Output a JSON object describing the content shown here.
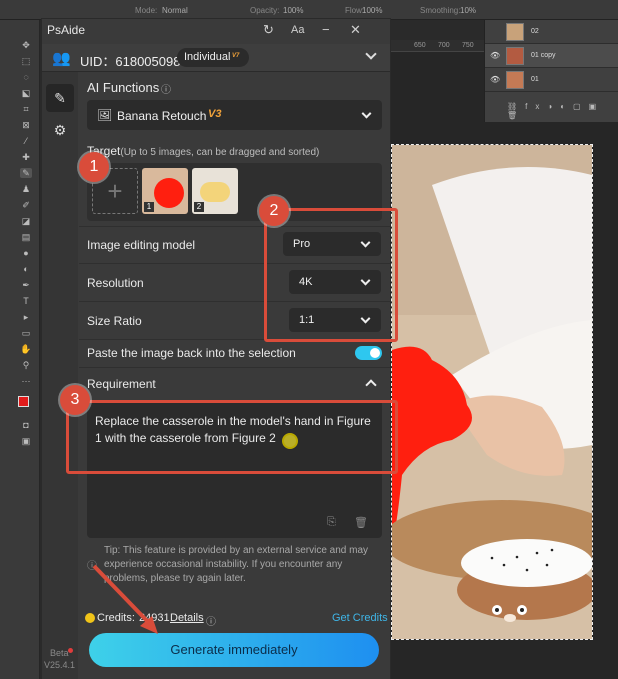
{
  "options_bar": {
    "mode_label": "Mode:",
    "mode_value": "Normal",
    "opacity_label": "Opacity:",
    "opacity_value": "100%",
    "flow_label": "Flow:",
    "flow_value": "100%",
    "smoothing_label": "Smoothing:",
    "smoothing_value": "10%"
  },
  "ruler": {
    "ticks": [
      "650",
      "700",
      "750"
    ]
  },
  "layers": [
    {
      "name": "02",
      "visible": false
    },
    {
      "name": "01 copy",
      "visible": true
    },
    {
      "name": "01",
      "visible": true
    }
  ],
  "app": {
    "title": "PsAide",
    "uid": "UID：618005098",
    "account_type": "Individual",
    "account_version": "V7",
    "beta_label": "Beta",
    "version": "V25.4.1"
  },
  "ai_functions": {
    "label": "AI Functions",
    "selected": "Banana Retouch",
    "selected_badge": "V3"
  },
  "target": {
    "label": "Target",
    "hint": "(Up to 5 images, can be dragged and sorted)",
    "image_numbers": [
      "1",
      "2"
    ]
  },
  "settings": {
    "model_label": "Image editing model",
    "model_value": "Pro",
    "resolution_label": "Resolution",
    "resolution_value": "4K",
    "ratio_label": "Size Ratio",
    "ratio_value": "1:1",
    "paste_back_label": "Paste the image back into the selection",
    "paste_back_on": true
  },
  "requirement": {
    "label": "Requirement",
    "text": "Replace the casserole in the model's hand in Figure 1 with the casserole from Figure 2"
  },
  "tip": "Tip: This feature is provided by an external service and may experience occasional instability. If you encounter any problems, please try again later.",
  "credits": {
    "label": "Credits:",
    "value": "24931",
    "details": "Details",
    "get_credits": "Get Credits"
  },
  "generate_label": "Generate immediately",
  "callouts": [
    "1",
    "2",
    "3"
  ],
  "colors": {
    "accent": "#d94c3a",
    "button_start": "#3ed1e9",
    "button_end": "#1e8ff0",
    "link": "#3fb6e8",
    "badge": "#f0a23a"
  }
}
